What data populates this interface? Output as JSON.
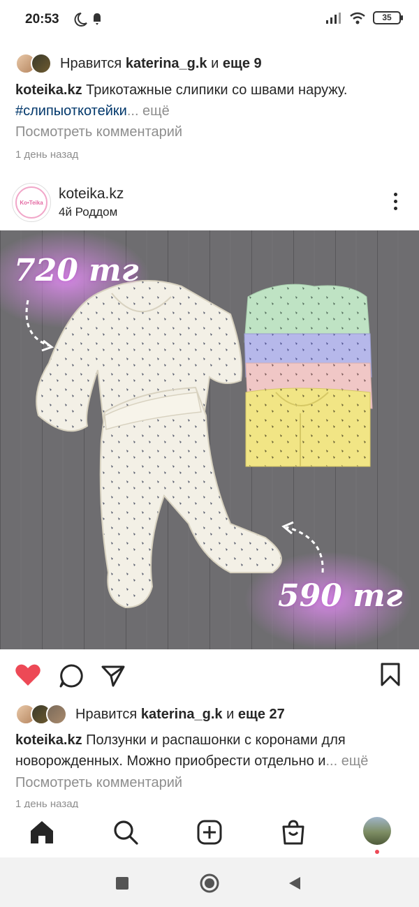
{
  "status_bar": {
    "time": "20:53",
    "battery": "35"
  },
  "post1": {
    "likes": {
      "prefix": "Нравится",
      "user": "katerina_g.k",
      "and": "и",
      "others": "еще 9"
    },
    "caption": {
      "username": "koteika.kz",
      "text": "Трикотажные слипики со швами наружу.",
      "hashtag": "#слипыоткотейки",
      "more": "... ещё"
    },
    "comments_link": "Посмотреть комментарий",
    "time_ago": "1 день назад"
  },
  "post2": {
    "header": {
      "username": "koteika.kz",
      "location": "4й Роддом",
      "avatar_text": "Ko•Teika"
    },
    "image": {
      "price_top": "720 тг",
      "price_bottom": "590 тг"
    },
    "likes": {
      "prefix": "Нравится",
      "user": "katerina_g.k",
      "and": "и",
      "others": "еще 27"
    },
    "caption": {
      "username": "koteika.kz",
      "text": "Ползунки и распашонки с коронами для новорожденных. Можно приобрести отдельно и",
      "more": "... ещё"
    },
    "comments_link": "Посмотреть комментарий",
    "time_ago": "1 день назад"
  },
  "colors": {
    "like_red": "#ed4956",
    "hashtag": "#00376b",
    "secondary_text": "#8e8e8e"
  }
}
